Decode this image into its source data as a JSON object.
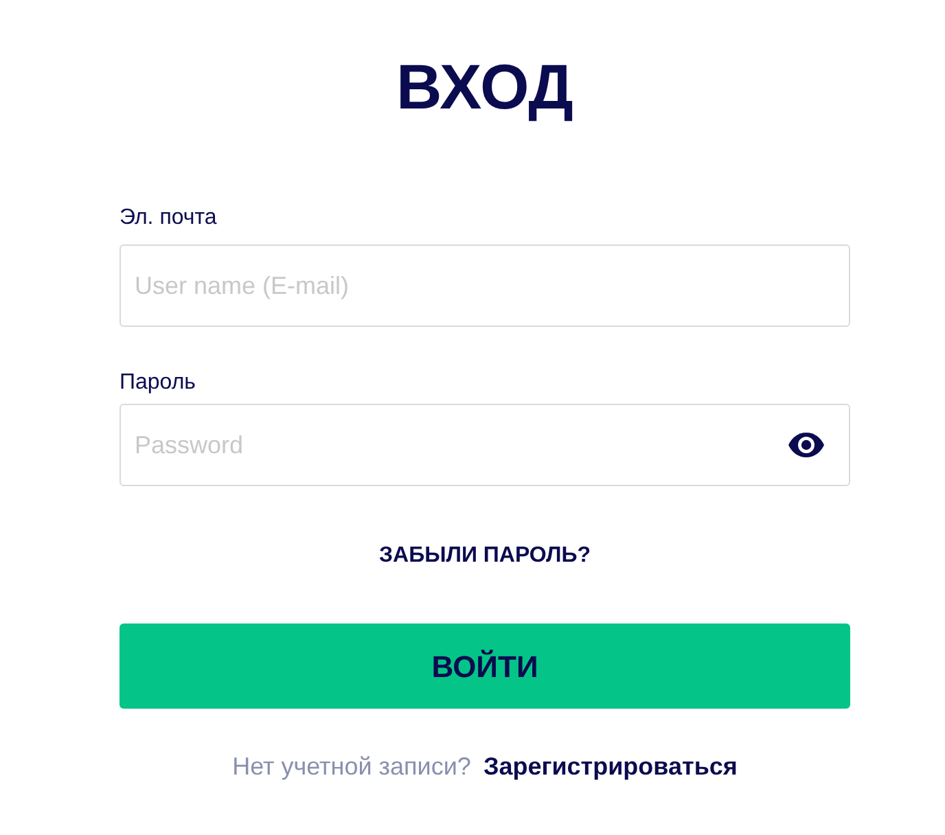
{
  "title": "ВХОД",
  "fields": [
    {
      "kind": "text",
      "label": "Эл. почта",
      "placeholder": "User name (E-mail)"
    },
    {
      "kind": "password",
      "label": "Пароль",
      "placeholder": "Password"
    }
  ],
  "forgot_link": "ЗАБЫЛИ ПАРОЛЬ?",
  "submit_button": "ВОЙТИ",
  "signup": {
    "prompt": "Нет учетной записи?",
    "link": "Зарегистрироваться"
  }
}
